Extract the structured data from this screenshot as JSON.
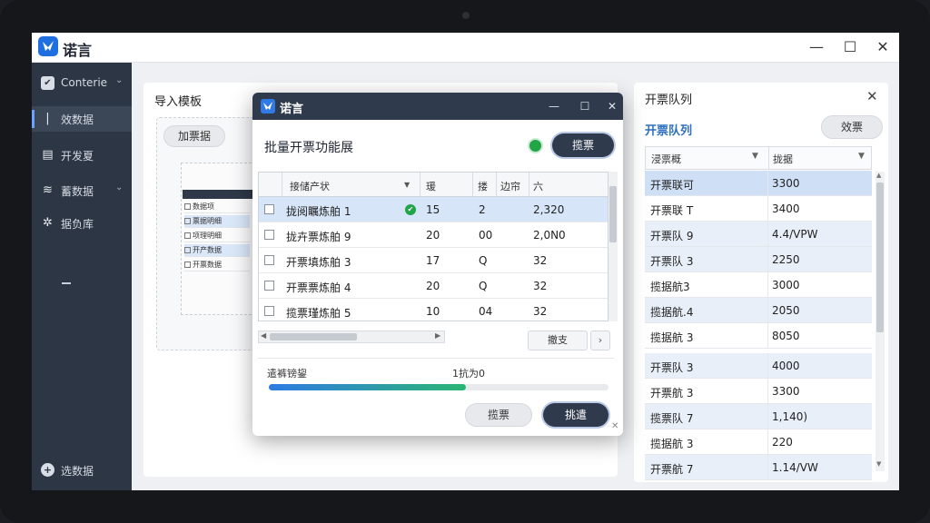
{
  "app": {
    "title": "诺言"
  },
  "sidebar": {
    "items": [
      {
        "label": "Conterie",
        "icon": "check-icon"
      },
      {
        "label": "效数据",
        "icon": "pipe-icon"
      },
      {
        "label": "开发夏",
        "icon": "document-icon"
      },
      {
        "label": "蓄数据",
        "icon": "layers-icon"
      },
      {
        "label": "据负库",
        "icon": "gear-icon"
      },
      {
        "label": ""
      },
      {
        "label": "选数据",
        "icon": "plus-circle-icon"
      }
    ]
  },
  "import_panel": {
    "title": "导入模板",
    "button": "加票据",
    "thumb_rows": [
      "数据项",
      "票据明细",
      "项理明细",
      "开产数据",
      "开票数据"
    ]
  },
  "queue_panel": {
    "title": "开票队列",
    "subtitle": "开票队列",
    "button": "效票",
    "columns": [
      "浸票概",
      "拢据"
    ],
    "rows": [
      {
        "name": "开票联可",
        "value": "3300"
      },
      {
        "name": "开票联 T",
        "value": "3400"
      },
      {
        "name": "开票队 9",
        "value": "4.4/VPW"
      },
      {
        "name": "开票队 3",
        "value": "2250"
      },
      {
        "name": "揽据航3",
        "value": "3000"
      },
      {
        "name": "揽据航.4",
        "value": "2050"
      },
      {
        "name": "揽据航 3",
        "value": "8050"
      },
      {
        "name": "开票队 3",
        "value": "4000"
      },
      {
        "name": "开票航 3",
        "value": "3300"
      },
      {
        "name": "揽票队 7",
        "value": "1,140)"
      },
      {
        "name": "揽据航 3",
        "value": "220"
      },
      {
        "name": "开票航 7",
        "value": "1.14/VW"
      }
    ]
  },
  "dialog": {
    "title": "诺言",
    "heading": "批量开票功能展",
    "primary": "揽票",
    "columns": [
      "接储产状",
      "瑗",
      "搂",
      "边帘",
      "六"
    ],
    "rows": [
      {
        "name": "拢阅瞩炼舶 1",
        "c1": "15",
        "c2": "2",
        "c3": "",
        "c4": "2,320"
      },
      {
        "name": "拢卉票炼舶 9",
        "c1": "20",
        "c2": "00",
        "c3": "",
        "c4": "2,0N0"
      },
      {
        "name": "开票填炼舶 3",
        "c1": "17",
        "c2": "Q",
        "c3": "",
        "c4": "32"
      },
      {
        "name": "开票票炼舶 4",
        "c1": "20",
        "c2": "Q",
        "c3": "",
        "c4": "32"
      },
      {
        "name": "揽票瑾炼舶 5",
        "c1": "10",
        "c2": "04",
        "c3": "",
        "c4": "32"
      }
    ],
    "small_button": "撤支",
    "small_arrow": "›",
    "progress_label": "遣裤镑鋆",
    "progress_value": "1抗为0",
    "progress_fraction": 0.58,
    "secondary": "揽票",
    "confirm": "挑遣"
  }
}
